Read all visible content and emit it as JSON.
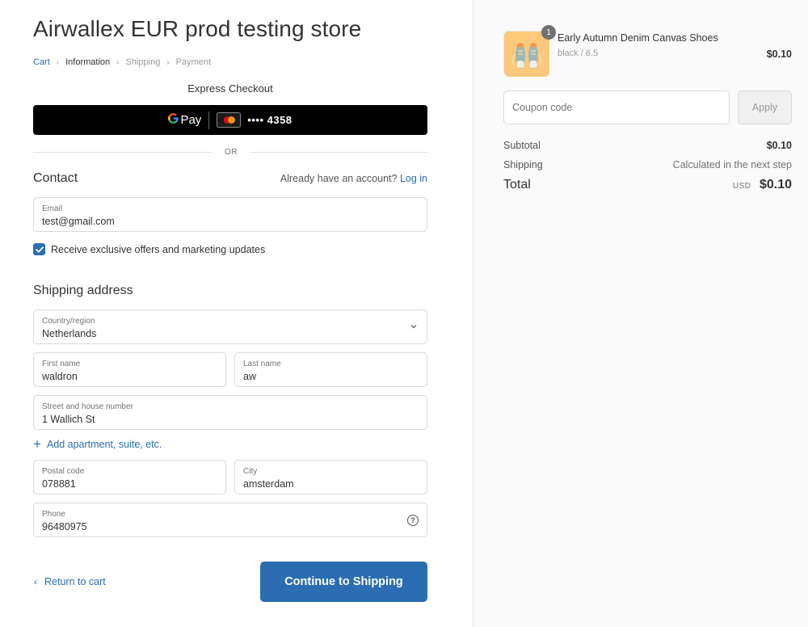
{
  "store": {
    "title": "Airwallex EUR prod testing store"
  },
  "breadcrumb": [
    {
      "label": "Cart",
      "state": "link"
    },
    {
      "label": "Information",
      "state": "current"
    },
    {
      "label": "Shipping",
      "state": "upcoming"
    },
    {
      "label": "Payment",
      "state": "upcoming"
    }
  ],
  "breadcrumb_separator": "›",
  "express": {
    "title": "Express Checkout",
    "gpay_g": "G",
    "gpay_text": "Pay",
    "card_masked": "•••• 4358",
    "card_brand_icon": "mastercard-icon",
    "or_label": "OR"
  },
  "contact": {
    "heading": "Contact",
    "account_prompt": "Already have an account?",
    "login_link": "Log in",
    "email": {
      "label": "Email",
      "value": "test@gmail.com"
    },
    "marketing_checkbox": {
      "label": "Receive exclusive offers and marketing updates",
      "checked": true
    }
  },
  "shipping": {
    "heading": "Shipping address",
    "country": {
      "label": "Country/region",
      "value": "Netherlands"
    },
    "first_name": {
      "label": "First name",
      "value": "waldron"
    },
    "last_name": {
      "label": "Last name",
      "value": "aw"
    },
    "street": {
      "label": "Street and house number",
      "value": "1 Wallich St"
    },
    "add_apartment": "Add apartment, suite, etc.",
    "postal_code": {
      "label": "Postal code",
      "value": "078881"
    },
    "city": {
      "label": "City",
      "value": "amsterdam"
    },
    "phone": {
      "label": "Phone",
      "value": "96480975"
    }
  },
  "footer": {
    "return_link": "Return to cart",
    "continue_button": "Continue to Shipping"
  },
  "summary": {
    "item": {
      "quantity": "1",
      "name": "Early Autumn Denim Canvas Shoes",
      "variant": "black / 6.5",
      "price": "$0.10"
    },
    "coupon": {
      "placeholder": "Coupon code",
      "apply_label": "Apply"
    },
    "subtotal": {
      "label": "Subtotal",
      "value": "$0.10"
    },
    "shipping": {
      "label": "Shipping",
      "value": "Calculated in the next step"
    },
    "total": {
      "label": "Total",
      "currency": "USD",
      "value": "$0.10"
    }
  },
  "colors": {
    "accent": "#2a6db0",
    "sidebar_bg": "#fafafa",
    "express_button_bg": "#000000"
  }
}
